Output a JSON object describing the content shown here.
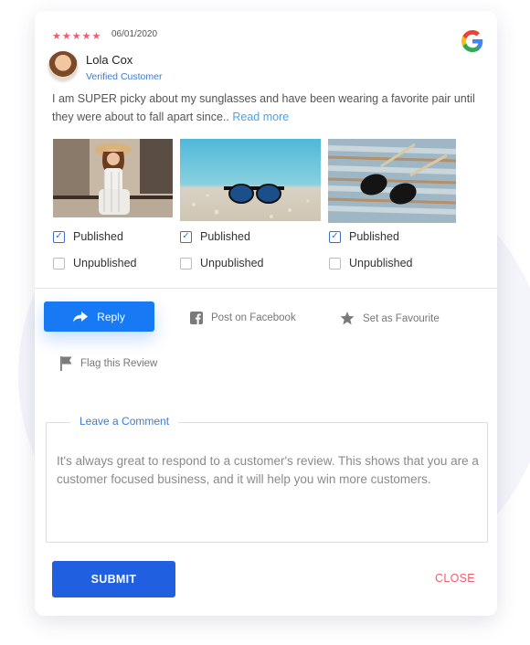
{
  "review": {
    "rating": 5,
    "stars": "★★★★★",
    "date": "06/01/2020",
    "source_icon": "google-icon",
    "author": "Lola Cox",
    "author_status": "Verified Customer",
    "text": "I am SUPER picky about my sunglasses and have been wearing a favorite pair until they were about to fall apart since..",
    "read_more_label": "Read more"
  },
  "photos": [
    {
      "name": "woman-photo",
      "published": true,
      "published_label": "Published",
      "unpublished_label": "Unpublished"
    },
    {
      "name": "sunglasses-beach-photo",
      "published": true,
      "published_label": "Published",
      "unpublished_label": "Unpublished"
    },
    {
      "name": "sunglasses-wood-photo",
      "published": true,
      "published_label": "Published",
      "unpublished_label": "Unpublished"
    }
  ],
  "actions": {
    "reply_label": "Reply",
    "facebook_label": "Post on Facebook",
    "favourite_label": "Set as Favourite",
    "flag_label": "Flag this Review"
  },
  "comment": {
    "legend": "Leave a Comment",
    "placeholder": "It's always great to respond to a customer's review. This shows that you are a customer focused business, and it will help you win more customers."
  },
  "footer": {
    "submit_label": "SUBMIT",
    "close_label": "CLOSE"
  },
  "colors": {
    "accent_blue": "#1779f3",
    "submit_blue": "#1f5fe0",
    "star_red": "#ef5d6e",
    "link_blue": "#4aa3e8"
  }
}
